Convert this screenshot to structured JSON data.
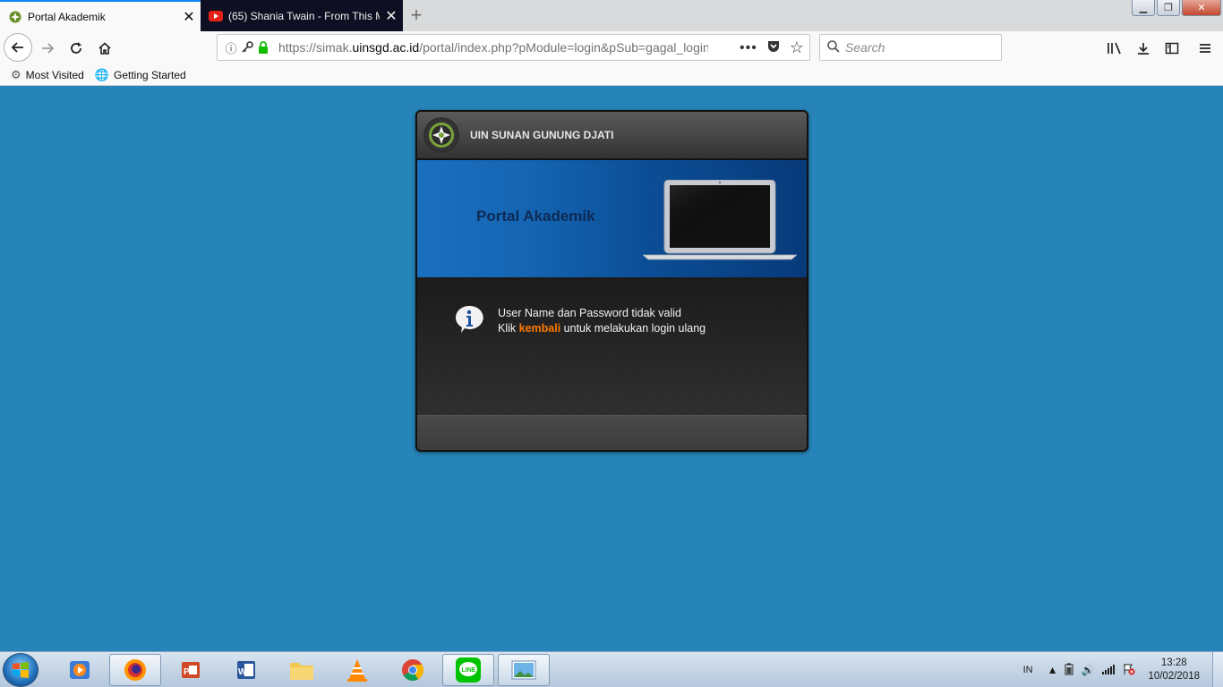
{
  "browser": {
    "tabs": [
      {
        "title": "Portal Akademik",
        "active": true
      },
      {
        "title": "(65) Shania Twain - From This M",
        "active": false
      }
    ],
    "url_prefix": "https://simak.",
    "url_domain": "uinsgd.ac.id",
    "url_path": "/portal/index.php?pModule=login&pSub=gagal_login",
    "search_placeholder": "Search",
    "bookmarks": [
      {
        "label": "Most Visited",
        "icon": "gear-icon"
      },
      {
        "label": "Getting Started",
        "icon": "globe-icon"
      }
    ]
  },
  "page": {
    "university": "UIN SUNAN GUNUNG DJATI",
    "portal_title": "Portal Akademik",
    "message_line1": "User Name dan Password tidak valid",
    "message_prefix": "Klik ",
    "message_link": "kembali",
    "message_suffix": " untuk melakukan login ulang"
  },
  "taskbar": {
    "lang": "IN",
    "time": "13:28",
    "date": "10/02/2018",
    "apps": [
      "media-player",
      "firefox",
      "powerpoint",
      "word",
      "file-explorer",
      "vlc",
      "chrome",
      "line",
      "photos"
    ]
  },
  "colors": {
    "desktop_bg": "#2684b8",
    "link_orange": "#ff7a00",
    "active_tab_accent": "#0a84ff"
  }
}
